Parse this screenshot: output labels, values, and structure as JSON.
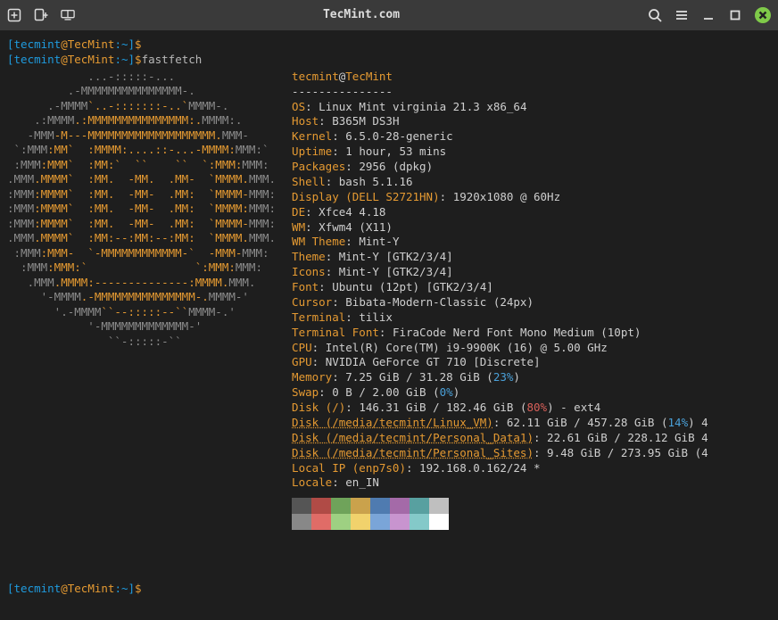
{
  "titlebar": {
    "title": "TecMint.com"
  },
  "prompts": {
    "p1_user": "tecmint",
    "p1_host": "TecMint",
    "p1_path": "~",
    "p1_cmd": "",
    "p2_user": "tecmint",
    "p2_host": "TecMint",
    "p2_path": "~",
    "p2_cmd": "fastfetch",
    "p3_user": "tecmint",
    "p3_host": "TecMint",
    "p3_path": "~",
    "p3_cmd": ""
  },
  "ff_header": {
    "user": "tecmint",
    "host": "TecMint",
    "rule": "---------------"
  },
  "info": [
    {
      "k": "OS",
      "v": "Linux Mint virginia 21.3 x86_64"
    },
    {
      "k": "Host",
      "v": "B365M DS3H"
    },
    {
      "k": "Kernel",
      "v": "6.5.0-28-generic"
    },
    {
      "k": "Uptime",
      "v": "1 hour, 53 mins"
    },
    {
      "k": "Packages",
      "v": "2956 (dpkg)"
    },
    {
      "k": "Shell",
      "v": "bash 5.1.16"
    },
    {
      "k": "Display (DELL S2721HN)",
      "v": "1920x1080 @ 60Hz"
    },
    {
      "k": "DE",
      "v": "Xfce4 4.18"
    },
    {
      "k": "WM",
      "v": "Xfwm4 (X11)"
    },
    {
      "k": "WM Theme",
      "v": "Mint-Y"
    },
    {
      "k": "Theme",
      "v": "Mint-Y [GTK2/3/4]"
    },
    {
      "k": "Icons",
      "v": "Mint-Y [GTK2/3/4]"
    },
    {
      "k": "Font",
      "v": "Ubuntu (12pt) [GTK2/3/4]"
    },
    {
      "k": "Cursor",
      "v": "Bibata-Modern-Classic (24px)"
    },
    {
      "k": "Terminal",
      "v": "tilix"
    },
    {
      "k": "Terminal Font",
      "v": "FiraCode Nerd Font Mono Medium (10pt)"
    },
    {
      "k": "CPU",
      "v": "Intel(R) Core(TM) i9-9900K (16) @ 5.00 GHz"
    },
    {
      "k": "GPU",
      "v": "NVIDIA GeForce GT 710 [Discrete]"
    },
    {
      "k": "Memory",
      "v_pre": "7.25 GiB / 31.28 GiB (",
      "pct": "23%",
      "pct_cls": "pct-b",
      "v_post": ")"
    },
    {
      "k": "Swap",
      "v_pre": "0 B / 2.00 GiB (",
      "pct": "0%",
      "pct_cls": "pct-b",
      "v_post": ")"
    },
    {
      "k": "Disk (/)",
      "v_pre": "146.31 GiB / 182.46 GiB (",
      "pct": "80%",
      "pct_cls": "pct-r",
      "v_post": ") - ext4"
    },
    {
      "k_link": "Disk (/media/tecmint/Linux_VM)",
      "v_pre": "62.11 GiB / 457.28 GiB (",
      "pct": "14%",
      "pct_cls": "pct-b",
      "v_post": ") 4"
    },
    {
      "k_link": "Disk (/media/tecmint/Personal_Data1)",
      "v": "22.61 GiB / 228.12 GiB 4"
    },
    {
      "k_link": "Disk (/media/tecmint/Personal_Sites)",
      "v": "9.48 GiB / 273.95 GiB (4"
    },
    {
      "k": "Local IP (enp7s0)",
      "v": "192.168.0.162/24 *"
    },
    {
      "k": "Locale",
      "v": "en_IN"
    }
  ],
  "logo_lines": [
    {
      "t": "            ...-:::::-...",
      "cls": "lg-g"
    },
    {
      "t": "         .-MMMMMMMMMMMMMMM-.",
      "cls": "lg-g"
    },
    {
      "t": "      .-MMMM",
      "cls": "lg-g",
      "tail": [
        {
          "t": "`..-:::::::-..`",
          "cls": "lg-o"
        },
        {
          "t": "MMMM-.",
          "cls": "lg-g"
        }
      ]
    },
    {
      "t": "    .:MMMM",
      "cls": "lg-g",
      "tail": [
        {
          "t": ".:MMMMMMMMMMMMMMM:.",
          "cls": "lg-o"
        },
        {
          "t": "MMMM:.",
          "cls": "lg-g"
        }
      ]
    },
    {
      "t": "   -MMM",
      "cls": "lg-g",
      "tail": [
        {
          "t": "-M---MMMMMMMMMMMMMMMMMMM.",
          "cls": "lg-o"
        },
        {
          "t": "MMM-",
          "cls": "lg-g"
        }
      ]
    },
    {
      "t": " `:MMM",
      "cls": "lg-g",
      "tail": [
        {
          "t": ":MM`  :MMMM:....::-...-MMMM:",
          "cls": "lg-o"
        },
        {
          "t": "MMM:`",
          "cls": "lg-g"
        }
      ]
    },
    {
      "t": " :MMM",
      "cls": "lg-g",
      "tail": [
        {
          "t": ":MMM`  :MM:`  ``    ``  `:MMM:",
          "cls": "lg-o"
        },
        {
          "t": "MMM:",
          "cls": "lg-g"
        }
      ]
    },
    {
      "t": ".MMM",
      "cls": "lg-g",
      "tail": [
        {
          "t": ".MMMM`  :MM.  -MM.  .MM-  `MMMM.",
          "cls": "lg-o"
        },
        {
          "t": "MMM.",
          "cls": "lg-g"
        }
      ]
    },
    {
      "t": ":MMM",
      "cls": "lg-g",
      "tail": [
        {
          "t": ":MMMM`  :MM.  -MM-  .MM:  `MMMM-",
          "cls": "lg-o"
        },
        {
          "t": "MMM:",
          "cls": "lg-g"
        }
      ]
    },
    {
      "t": ":MMM",
      "cls": "lg-g",
      "tail": [
        {
          "t": ":MMMM`  :MM.  -MM-  .MM:  `MMMM:",
          "cls": "lg-o"
        },
        {
          "t": "MMM:",
          "cls": "lg-g"
        }
      ]
    },
    {
      "t": ":MMM",
      "cls": "lg-g",
      "tail": [
        {
          "t": ":MMMM`  :MM.  -MM-  .MM:  `MMMM-",
          "cls": "lg-o"
        },
        {
          "t": "MMM:",
          "cls": "lg-g"
        }
      ]
    },
    {
      "t": ".MMM",
      "cls": "lg-g",
      "tail": [
        {
          "t": ".MMMM`  :MM:--:MM:--:MM:  `MMMM.",
          "cls": "lg-o"
        },
        {
          "t": "MMM.",
          "cls": "lg-g"
        }
      ]
    },
    {
      "t": " :MMM",
      "cls": "lg-g",
      "tail": [
        {
          "t": ":MMM-  `-MMMMMMMMMMMM-`  -MMM-",
          "cls": "lg-o"
        },
        {
          "t": "MMM:",
          "cls": "lg-g"
        }
      ]
    },
    {
      "t": "  :MMM",
      "cls": "lg-g",
      "tail": [
        {
          "t": ":MMM:`                `:MMM:",
          "cls": "lg-o"
        },
        {
          "t": "MMM:",
          "cls": "lg-g"
        }
      ]
    },
    {
      "t": "   .MMM",
      "cls": "lg-g",
      "tail": [
        {
          "t": ".MMMM:--------------:MMMM.",
          "cls": "lg-o"
        },
        {
          "t": "MMM.",
          "cls": "lg-g"
        }
      ]
    },
    {
      "t": "     '-MMMM",
      "cls": "lg-g",
      "tail": [
        {
          "t": ".-MMMMMMMMMMMMMMM-.",
          "cls": "lg-o"
        },
        {
          "t": "MMMM-'",
          "cls": "lg-g"
        }
      ]
    },
    {
      "t": "       '.-MMMM",
      "cls": "lg-g",
      "tail": [
        {
          "t": "``--:::::--``",
          "cls": "lg-o"
        },
        {
          "t": "MMMM-.'",
          "cls": "lg-g"
        }
      ]
    },
    {
      "t": "            '-MMMMMMMMMMMMM-'",
      "cls": "lg-g"
    },
    {
      "t": "               ``-:::::-``",
      "cls": "lg-g"
    }
  ],
  "swatches": {
    "dark": [
      "#555555",
      "#b04b46",
      "#6fa35a",
      "#caa24c",
      "#4f7bb0",
      "#a46aa8",
      "#58a0a0",
      "#bfbfbf"
    ],
    "light": [
      "#888888",
      "#e06c67",
      "#9ed082",
      "#f1d26c",
      "#7aa5d8",
      "#c894cf",
      "#84c9c9",
      "#ffffff"
    ]
  }
}
